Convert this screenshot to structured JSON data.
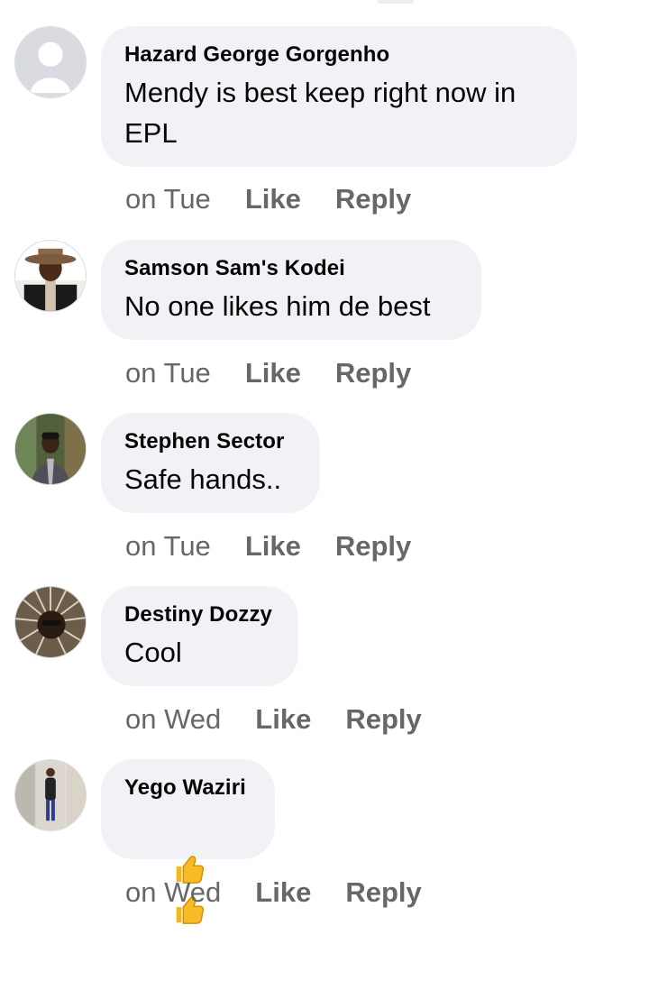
{
  "comments": [
    {
      "author": "Hazard George Gorgenho",
      "text": "Mendy is best keep right now in EPL",
      "time": "on Tue",
      "avatar": "default-profile-avatar"
    },
    {
      "author": "Samson Sam's Kodei",
      "text": "No one likes him de best",
      "time": "on Tue",
      "avatar": "profile-photo-man-hat"
    },
    {
      "author": "Stephen Sector",
      "text": "Safe hands..",
      "time": "on Tue",
      "avatar": "profile-photo-man-suit"
    },
    {
      "author": "Destiny Dozzy",
      "text": "Cool",
      "time": "on Wed",
      "avatar": "profile-photo-rays"
    },
    {
      "author": "Yego Waziri",
      "text": "👍👍",
      "time": "on Wed",
      "avatar": "profile-photo-standing-man"
    }
  ],
  "actions": {
    "like": "Like",
    "reply": "Reply"
  },
  "colors": {
    "bubble": "#f0f2f5",
    "name": "#050505",
    "meta": "#65676b"
  },
  "icons": {
    "reaction": "thumbs-up-icon"
  }
}
